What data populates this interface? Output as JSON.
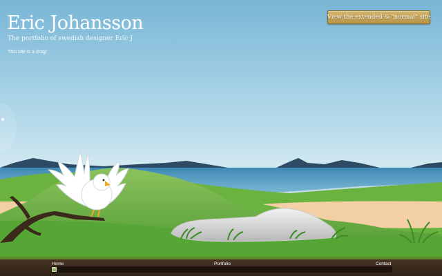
{
  "header": {
    "title": "Eric Johansson",
    "subtitle": "The portfolio of swedish designer Eric J",
    "note": "This site is a drag!"
  },
  "extended_link": {
    "label": "View the extended & \"normal\" site"
  },
  "footer": {
    "nav": [
      {
        "label": "Home"
      },
      {
        "label": "Portfolio"
      },
      {
        "label": "Contact"
      }
    ],
    "scroll_position": 0
  },
  "colors": {
    "sky_top": "#7ebad8",
    "sky_bottom": "#cfe6f0",
    "sea": "#5a9ec4",
    "hills": "#2e4c68",
    "grass": "#5aa83a",
    "sand": "#f2cfa6",
    "footer": "#3a2a1c",
    "button_gold": "#c9a95c"
  },
  "icons": [
    "bird-illustration",
    "rock-illustration",
    "branch-illustration",
    "drag-handle-icon"
  ]
}
